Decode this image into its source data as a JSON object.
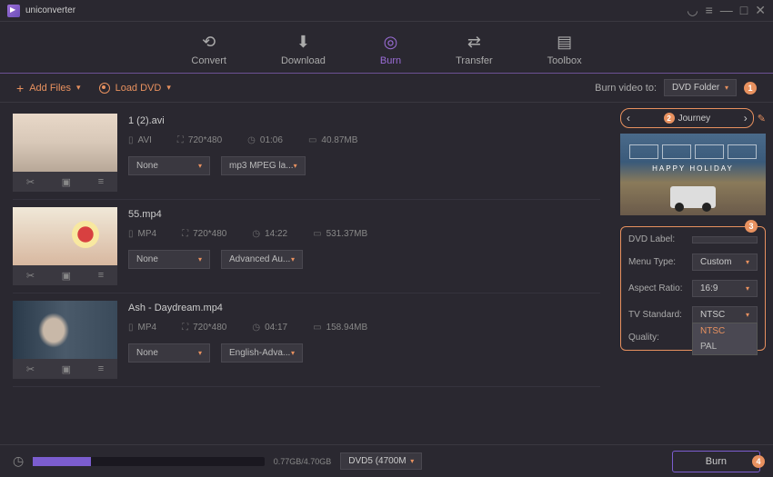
{
  "app": {
    "title": "uniconverter"
  },
  "nav": {
    "convert": "Convert",
    "download": "Download",
    "burn": "Burn",
    "transfer": "Transfer",
    "toolbox": "Toolbox"
  },
  "toolbar": {
    "add_files": "Add Files",
    "load_dvd": "Load DVD",
    "burn_video_to": "Burn video to:",
    "target": "DVD Folder"
  },
  "files": [
    {
      "name": "1 (2).avi",
      "format": "AVI",
      "resolution": "720*480",
      "duration": "01:06",
      "size": "40.87MB",
      "subtitle": "None",
      "audio": "mp3 MPEG la..."
    },
    {
      "name": "55.mp4",
      "format": "MP4",
      "resolution": "720*480",
      "duration": "14:22",
      "size": "531.37MB",
      "subtitle": "None",
      "audio": "Advanced Au..."
    },
    {
      "name": "Ash - Daydream.mp4",
      "format": "MP4",
      "resolution": "720*480",
      "duration": "04:17",
      "size": "158.94MB",
      "subtitle": "None",
      "audio": "English-Adva..."
    }
  ],
  "theme": {
    "name": "Journey",
    "preview_text": "HAPPY HOLIDAY"
  },
  "settings": {
    "dvd_label_lbl": "DVD Label:",
    "dvd_label_val": "",
    "menu_type_lbl": "Menu Type:",
    "menu_type_val": "Custom",
    "aspect_ratio_lbl": "Aspect Ratio:",
    "aspect_ratio_val": "16:9",
    "tv_standard_lbl": "TV Standard:",
    "tv_standard_val": "NTSC",
    "tv_options": [
      "NTSC",
      "PAL"
    ],
    "quality_lbl": "Quality:"
  },
  "bottom": {
    "disk_used": "0.77GB/4.70GB",
    "disk_type": "DVD5 (4700M",
    "burn_btn": "Burn"
  },
  "badges": {
    "b1": "1",
    "b2": "2",
    "b3": "3",
    "b4": "4"
  }
}
